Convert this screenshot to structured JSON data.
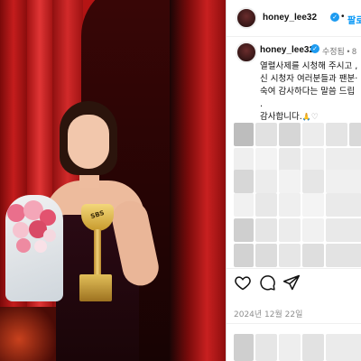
{
  "post": {
    "username": "honey_lee32",
    "follow_label": "팔로우",
    "dot": "•",
    "edited_label": "수정됨 • 8",
    "caption_lines": [
      "열렬사제를 시청해 주시고 ,",
      "신 시청자 여러분들과 팬분·",
      "숙여 감사하다는 말씀 드립",
      ".",
      "감사합니다."
    ],
    "date": "2024년 12월 22일"
  },
  "photo": {
    "trophy_text": "SBS"
  },
  "colors": {
    "follow": "#0095f6",
    "verified": "#1d9bf0",
    "curtain": "#b51414"
  },
  "icons": [
    "heart-icon",
    "comment-icon",
    "share-icon",
    "verified-badge-icon",
    "pray-emoji-icon",
    "small-heart-icon"
  ]
}
